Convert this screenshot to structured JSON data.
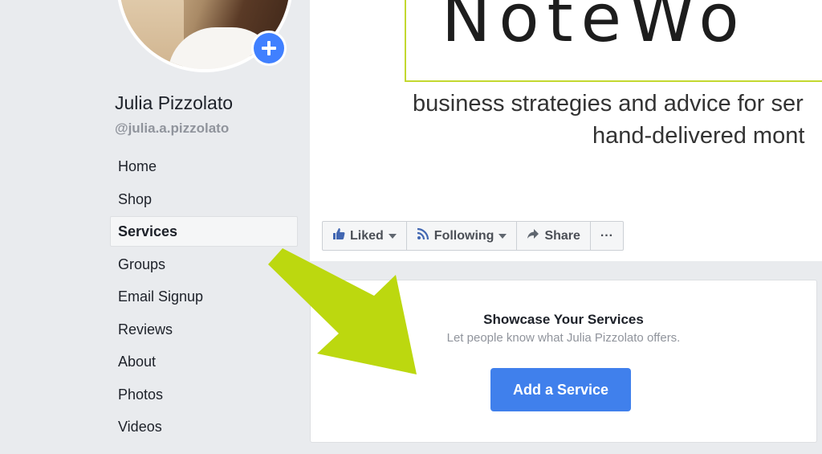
{
  "profile": {
    "name": "Julia Pizzolato",
    "handle": "@julia.a.pizzolato"
  },
  "nav": {
    "items": [
      {
        "label": "Home"
      },
      {
        "label": "Shop"
      },
      {
        "label": "Services",
        "active": true
      },
      {
        "label": "Groups"
      },
      {
        "label": "Email Signup"
      },
      {
        "label": "Reviews"
      },
      {
        "label": "About"
      },
      {
        "label": "Photos"
      },
      {
        "label": "Videos"
      }
    ]
  },
  "cover": {
    "logo_text": "NoteWo",
    "tagline_line1": "business strategies and advice for ser",
    "tagline_line2": "hand-delivered mont"
  },
  "actions": {
    "liked_label": "Liked",
    "following_label": "Following",
    "share_label": "Share",
    "more_label": "···"
  },
  "services_card": {
    "title": "Showcase Your Services",
    "subtitle": "Let people know what Julia Pizzolato offers.",
    "button_label": "Add a Service"
  },
  "colors": {
    "accent_blue": "#4080ec",
    "annotation_arrow": "#bcd80f",
    "logo_border": "#c3d830"
  },
  "icons": {
    "add_photo": "plus-icon",
    "liked": "thumbs-up-icon",
    "following": "rss-icon",
    "share": "share-arrow-icon",
    "more": "ellipsis-icon"
  }
}
